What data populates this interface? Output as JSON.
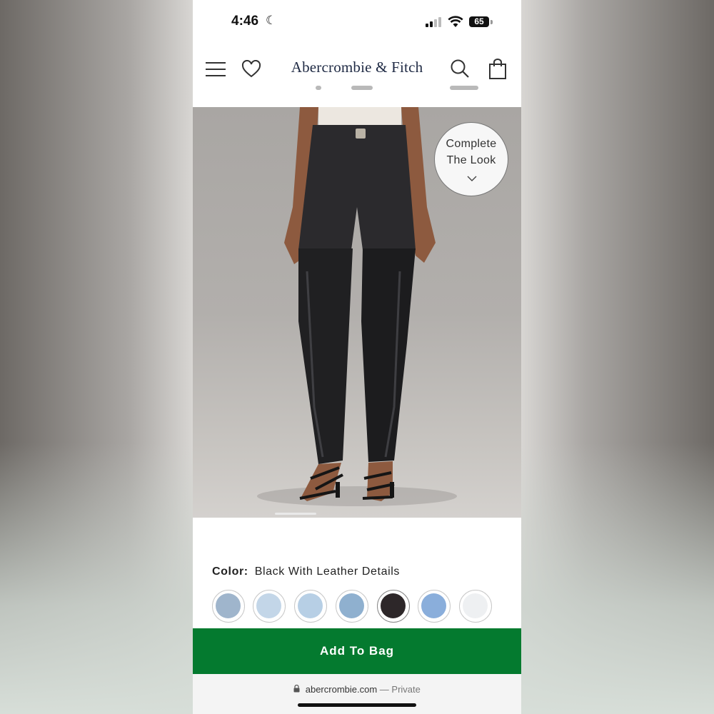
{
  "status_bar": {
    "time": "4:46",
    "battery": "65",
    "icons": [
      "moon-icon",
      "cellular-signal-icon",
      "wifi-icon",
      "battery-icon"
    ]
  },
  "nav": {
    "logo": "Abercrombie & Fitch",
    "icons": [
      "hamburger-menu-icon",
      "heart-icon",
      "search-icon",
      "shopping-bag-icon"
    ]
  },
  "hero": {
    "complete_the_look": "Complete The Look",
    "complete_the_look_line1": "Complete",
    "complete_the_look_line2": "The Look"
  },
  "color": {
    "label": "Color:",
    "value": "Black With Leather Details",
    "swatches": [
      {
        "hex": "#9fb5cc",
        "selected": false
      },
      {
        "hex": "#c3d6e8",
        "selected": false
      },
      {
        "hex": "#b7cfe5",
        "selected": false
      },
      {
        "hex": "#8fb0cf",
        "selected": false
      },
      {
        "hex": "#2d2729",
        "selected": true
      },
      {
        "hex": "#8aaedb",
        "selected": false
      },
      {
        "hex": "#eef0f2",
        "selected": false
      }
    ]
  },
  "actions": {
    "add_to_bag": "Add To Bag"
  },
  "browser": {
    "domain": "abercrombie.com",
    "separator": "—",
    "mode": "Private"
  },
  "colors": {
    "primary_green": "#047a2f",
    "logo_navy": "#1f2a44"
  }
}
